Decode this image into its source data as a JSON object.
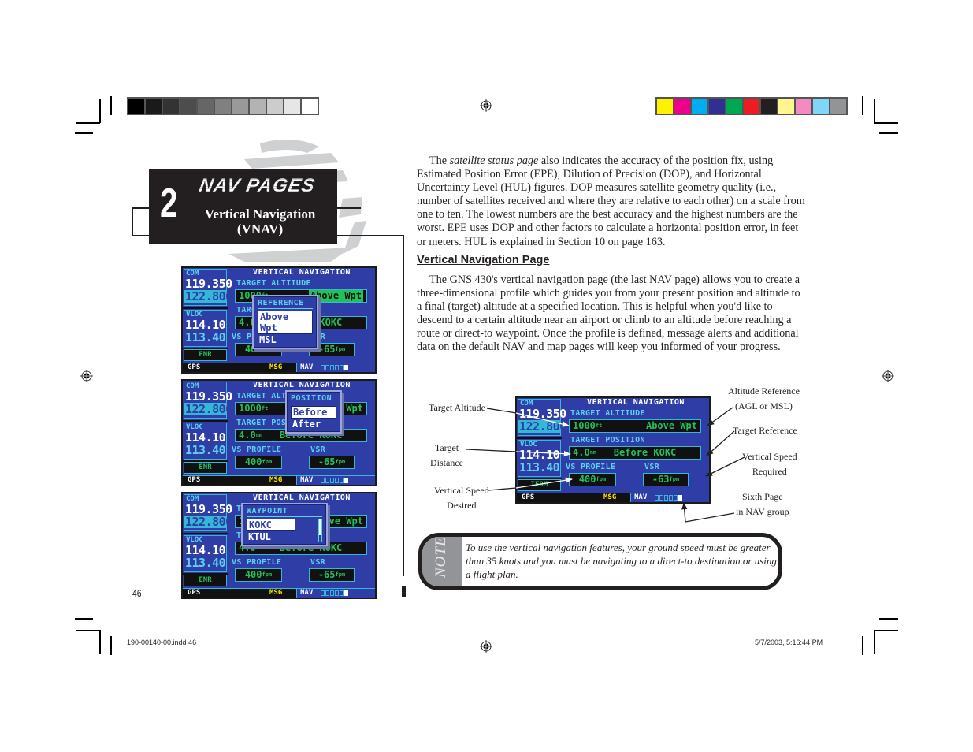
{
  "color_bars": {
    "grayscale": [
      "#000000",
      "#1a1a1a",
      "#333333",
      "#4d4d4d",
      "#666666",
      "#808080",
      "#999999",
      "#b3b3b3",
      "#cccccc",
      "#e6e6e6",
      "#ffffff"
    ],
    "process": [
      "#fff200",
      "#ec008c",
      "#00aeef",
      "#2e3192",
      "#00a651",
      "#ed1c24",
      "#231f20",
      "#fff68f",
      "#f58ac2",
      "#7fd6f7",
      "#929497"
    ]
  },
  "chapter": {
    "number": "2",
    "title": "NAV PAGES",
    "subtitle_line1": "Vertical Navigation",
    "subtitle_line2": "(VNAV)"
  },
  "screens": [
    {
      "com_label": "COM",
      "com_active": "119.350",
      "com_standby": "122.800",
      "vloc_label": "VLOC",
      "vloc_active": "114.10",
      "vloc_standby": "113.40",
      "mode": "ENR",
      "title": "VERTICAL NAVIGATION",
      "target_altitude_label": "TARGET ALTITUDE",
      "target_altitude": "1000",
      "altitude_unit": "ft",
      "altitude_ref": "Above Wpt",
      "target_position_label": "TARGET POSITION",
      "target_distance": "4.0",
      "distance_unit": "nm",
      "position_ref": "Before KOKC",
      "vs_profile_label": "VS PROFILE",
      "vs_profile": "400",
      "vs_unit": "fpm",
      "vsr_label": "VSR",
      "vsr": "-65",
      "status_gps": "GPS",
      "status_msg": "MSG",
      "status_nav": "NAV",
      "page_indicator": {
        "total": 6,
        "current": 6
      },
      "popup": {
        "title": "REFERENCE",
        "options": [
          "Above Wpt",
          "MSL"
        ],
        "selected": "Above Wpt"
      }
    },
    {
      "com_label": "COM",
      "com_active": "119.350",
      "com_standby": "122.800",
      "vloc_label": "VLOC",
      "vloc_active": "114.10",
      "vloc_standby": "113.40",
      "mode": "ENR",
      "title": "VERTICAL NAVIGATION",
      "target_altitude_label": "TARGET ALTITUDE",
      "target_altitude": "1000",
      "altitude_unit": "ft",
      "altitude_ref": "Above Wpt",
      "target_position_label": "TARGET POSITION",
      "target_distance": "4.0",
      "distance_unit": "nm",
      "position_ref": "Before KOKC",
      "vs_profile_label": "VS PROFILE",
      "vs_profile": "400",
      "vs_unit": "fpm",
      "vsr_label": "VSR",
      "vsr": "-65",
      "status_gps": "GPS",
      "status_msg": "MSG",
      "status_nav": "NAV",
      "page_indicator": {
        "total": 6,
        "current": 6
      },
      "popup": {
        "title": "POSITION",
        "options": [
          "Before",
          "After"
        ],
        "selected": "Before"
      }
    },
    {
      "com_label": "COM",
      "com_active": "119.350",
      "com_standby": "122.800",
      "vloc_label": "VLOC",
      "vloc_active": "114.10",
      "vloc_standby": "113.40",
      "mode": "ENR",
      "title": "VERTICAL NAVIGATION",
      "target_altitude_label": "TARGET ALTITUDE",
      "target_altitude": "1000",
      "altitude_unit": "ft",
      "altitude_ref": "Above Wpt",
      "target_position_label": "TARGET POSITION",
      "target_distance": "4.0",
      "distance_unit": "nm",
      "position_ref": "Before KOKC",
      "vs_profile_label": "VS PROFILE",
      "vs_profile": "400",
      "vs_unit": "fpm",
      "vsr_label": "VSR",
      "vsr": "-65",
      "status_gps": "GPS",
      "status_msg": "MSG",
      "status_nav": "NAV",
      "page_indicator": {
        "total": 6,
        "current": 6
      },
      "popup": {
        "title": "WAYPOINT",
        "options": [
          "KOKC",
          "KTUL"
        ],
        "selected": "KOKC"
      }
    },
    {
      "com_label": "COM",
      "com_active": "119.350",
      "com_standby": "122.800",
      "vloc_label": "VLOC",
      "vloc_active": "114.10",
      "vloc_standby": "113.40",
      "mode": "TERM",
      "title": "VERTICAL NAVIGATION",
      "target_altitude_label": "TARGET ALTITUDE",
      "target_altitude": "1000",
      "altitude_unit": "ft",
      "altitude_ref": "Above Wpt",
      "target_position_label": "TARGET POSITION",
      "target_distance": "4.0",
      "distance_unit": "nm",
      "position_ref": "Before KOKC",
      "vs_profile_label": "VS PROFILE",
      "vs_profile": "400",
      "vs_unit": "fpm",
      "vsr_label": "VSR",
      "vsr": "-63",
      "status_gps": "GPS",
      "status_msg": "MSG",
      "status_nav": "NAV",
      "page_indicator": {
        "total": 6,
        "current": 6
      }
    }
  ],
  "body": {
    "intro_pre": "The ",
    "intro_italic": "satellite status page",
    "intro_post": " also indicates the accuracy of the position fix, using Estimated Position Error (EPE), Dilution of Precision (DOP), and Horizontal Uncertainty Level (HUL) figures. DOP measures satellite geometry quality (i.e., number of satellites received and where they are relative to each other) on a scale from one to ten. The lowest numbers are the best accuracy and the highest numbers are the worst. EPE uses DOP and other factors to calculate a horizontal position error, in feet or meters.  HUL is explained in Section 10 on page 163.",
    "section_heading": "Vertical Navigation Page",
    "section_text": "The GNS 430's vertical navigation page (the last NAV page) allows you to create a three-dimensional profile which guides you from your present position and altitude to a final (target) altitude at a specified location. This is helpful when you'd like to descend to a certain altitude near an airport or climb to an altitude before reaching a route or direct-to waypoint. Once the profile is defined, message alerts and additional data on the default NAV and map pages will keep you informed of your progress."
  },
  "callouts": {
    "target_altitude": "Target Altitude",
    "target_distance_1": "Target",
    "target_distance_2": "Distance",
    "vs_desired_1": "Vertical Speed",
    "vs_desired_2": "Desired",
    "altitude_reference_1": "Altitude Reference",
    "altitude_reference_2": "(AGL or MSL)",
    "target_reference": "Target Reference",
    "vs_required_1": "Vertical Speed",
    "vs_required_2": "Required",
    "sixth_page_1": "Sixth Page",
    "sixth_page_2": "in NAV group"
  },
  "note": {
    "label": "NOTE",
    "text": "To use the vertical navigation features, your ground speed must be greater than 35 knots and you must be navigating to a direct-to destination or using a flight plan."
  },
  "footer": {
    "page_number": "46",
    "slug_file": "190-00140-00.indd   46",
    "slug_date": "5/7/2003, 5:16:44 PM"
  }
}
